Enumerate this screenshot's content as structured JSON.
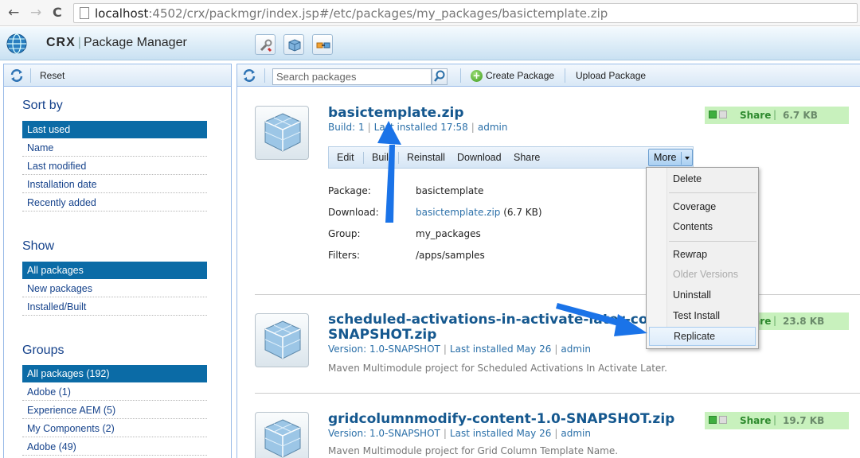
{
  "browser": {
    "nav_back": "←",
    "nav_fwd": "→",
    "nav_reload": "C",
    "url_host": "localhost",
    "url_rest": ":4502/crx/packmgr/index.jsp#/etc/packages/my_packages/basictemplate.zip"
  },
  "header": {
    "brand": "CRX",
    "separator": "|",
    "product": "Package Manager",
    "icons": [
      "tools-icon",
      "package-icon",
      "share-icon"
    ]
  },
  "sidebar": {
    "reset_label": "Reset",
    "sort_title": "Sort by",
    "sort_items": [
      "Last used",
      "Name",
      "Last modified",
      "Installation date",
      "Recently added"
    ],
    "show_title": "Show",
    "show_items": [
      "All packages",
      "New packages",
      "Installed/Built"
    ],
    "groups_title": "Groups",
    "group_items": [
      "All packages (192)",
      "Adobe (1)",
      "Experience AEM (5)",
      "My Components (2)",
      "Adobe (49)"
    ]
  },
  "toolbar": {
    "search_placeholder": "Search packages",
    "create_label": "Create Package",
    "upload_label": "Upload Package"
  },
  "packages": [
    {
      "title": "basictemplate.zip",
      "meta1": "Build: 1",
      "meta2": "Last installed 17:58",
      "meta3": "admin",
      "share_label": "Share",
      "size": "6.7 KB",
      "actions": [
        "Edit",
        "Build",
        "Reinstall",
        "Download",
        "Share"
      ],
      "more_label": "More",
      "props": [
        {
          "k": "Package:",
          "v": "basictemplate"
        },
        {
          "k": "Download:",
          "v": "basictemplate.zip",
          "extra": " (6.7 KB)"
        },
        {
          "k": "Group:",
          "v": "my_packages"
        },
        {
          "k": "Filters:",
          "v": "/apps/samples"
        }
      ]
    },
    {
      "title_line1": "scheduled-activations-in-activate-later-content-1.0-",
      "title_line2": "SNAPSHOT.zip",
      "meta1": "Version: 1.0-SNAPSHOT",
      "meta2": "Last installed May 26",
      "meta3": "admin",
      "share_label": "Share",
      "size": "23.8 KB",
      "desc": "Maven Multimodule project for Scheduled Activations In Activate Later."
    },
    {
      "title": "gridcolumnmodify-content-1.0-SNAPSHOT.zip",
      "meta1": "Version: 1.0-SNAPSHOT",
      "meta2": "Last installed May 26",
      "meta3": "admin",
      "share_label": "Share",
      "size": "19.7 KB",
      "desc": "Maven Multimodule project for Grid Column Template Name."
    }
  ],
  "more_menu": {
    "items": [
      "Delete",
      "Coverage",
      "Contents",
      "Rewrap",
      "Older Versions",
      "Uninstall",
      "Test Install",
      "Replicate"
    ],
    "disabled": [
      "Older Versions"
    ],
    "highlighted": "Replicate"
  },
  "colors": {
    "accent": "#0b6ba6",
    "link": "#15588f",
    "share_bg": "#c8f1bd",
    "annotation_arrow": "#1a73e8"
  }
}
